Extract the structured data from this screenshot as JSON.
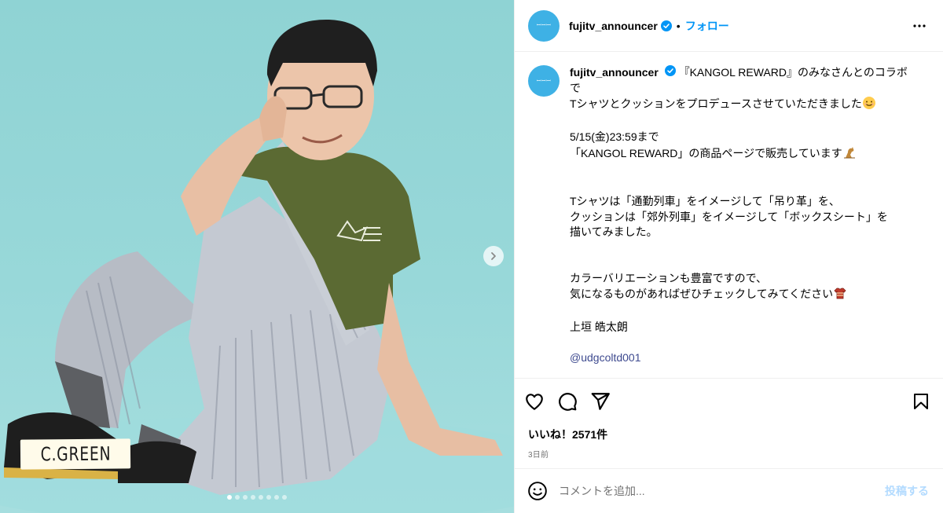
{
  "colors": {
    "accent": "#0095f6",
    "avatar": "#3eb1e5",
    "backdrop": "#95d6d7"
  },
  "media": {
    "photo_label": "C.GREEN",
    "carousel_count": 8,
    "carousel_active": 0
  },
  "header": {
    "avatar_text": "ꟷꟷꟷ",
    "username": "fujitv_announcer",
    "separator": "•",
    "follow_label": "フォロー"
  },
  "caption": {
    "username": "fujitv_announcer",
    "lines": [
      "『KANGOL REWARD』のみなさんとのコラボで",
      "Tシャツとクッションをプロデュースさせていただきました",
      "",
      "5/15(金)23:59まで",
      "「KANGOL REWARD」の商品ページで販売しています",
      "",
      "",
      "Tシャツは「通勤列車」をイメージして「吊り革」を、",
      "クッションは「郊外列車」をイメージして「ボックスシート」を",
      "描いてみました。",
      "",
      "",
      "カラーバリエーションも豊富ですので、",
      "気になるものがあればぜひチェックしてみてください",
      "",
      "上垣 皓太朗",
      "",
      "@udgcoltd001"
    ]
  },
  "actions": {
    "icons": [
      "heart-icon",
      "comment-icon",
      "share-icon",
      "bookmark-icon"
    ],
    "likes": "いいね！2571件",
    "time": "3日前"
  },
  "comment": {
    "placeholder": "コメントを追加...",
    "post_label": "投稿する"
  }
}
